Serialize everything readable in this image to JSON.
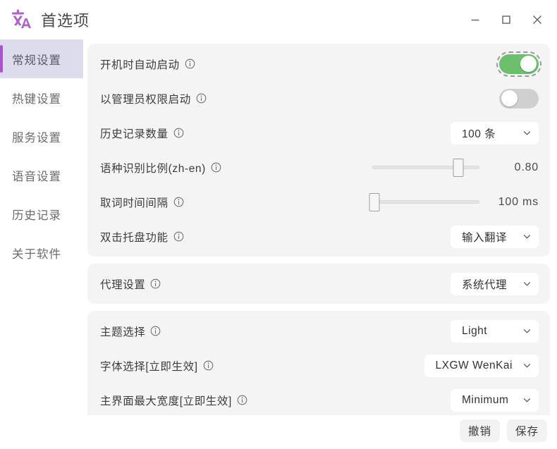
{
  "window": {
    "title": "首选项",
    "icon": "translate-icon",
    "accent_color": "#a855c8",
    "controls": {
      "minimize": "minimize-icon",
      "maximize": "maximize-icon",
      "close": "close-icon"
    }
  },
  "sidebar": {
    "items": [
      {
        "label": "常规设置",
        "active": true
      },
      {
        "label": "热键设置",
        "active": false
      },
      {
        "label": "服务设置",
        "active": false
      },
      {
        "label": "语音设置",
        "active": false
      },
      {
        "label": "历史记录",
        "active": false
      },
      {
        "label": "关于软件",
        "active": false
      }
    ]
  },
  "sections": [
    {
      "rows": [
        {
          "label": "开机时自动启动",
          "info": true,
          "control": "toggle",
          "state": "on",
          "focused": true,
          "color": "#6cc06c"
        },
        {
          "label": "以管理员权限启动",
          "info": true,
          "control": "toggle",
          "state": "off",
          "focused": false,
          "color": "#d0d0d0"
        },
        {
          "label": "历史记录数量",
          "info": true,
          "control": "dropdown",
          "value": "100 条",
          "width": "narrow"
        },
        {
          "label": "语种识别比例(zh-en)",
          "info": true,
          "control": "slider",
          "value": "0.80",
          "percent": 80
        },
        {
          "label": "取词时间间隔",
          "info": true,
          "control": "slider",
          "value": "100 ms",
          "percent": 2
        },
        {
          "label": "双击托盘功能",
          "info": true,
          "control": "dropdown",
          "value": "输入翻译",
          "width": "narrow"
        }
      ]
    },
    {
      "rows": [
        {
          "label": "代理设置",
          "info": true,
          "control": "dropdown",
          "value": "系统代理",
          "width": "narrow"
        }
      ]
    },
    {
      "rows": [
        {
          "label": "主题选择",
          "info": true,
          "control": "dropdown",
          "value": "Light",
          "width": "narrow"
        },
        {
          "label": "字体选择[立即生效]",
          "info": true,
          "control": "dropdown",
          "value": "LXGW WenKai",
          "width": "wide"
        },
        {
          "label": "主界面最大宽度[立即生效]",
          "info": true,
          "control": "dropdown",
          "value": "Minimum",
          "width": "narrow"
        },
        {
          "label": "",
          "info": false,
          "control": "dropdown",
          "value": "",
          "width": "narrow",
          "clipped": true
        }
      ]
    }
  ],
  "footer": {
    "cancel_label": "撤销",
    "save_label": "保存"
  }
}
